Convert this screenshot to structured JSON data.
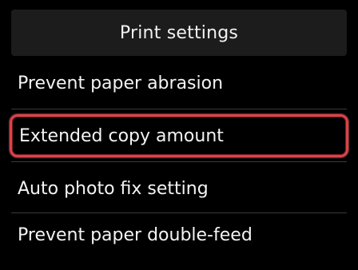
{
  "header": {
    "title": "Print settings"
  },
  "menu": {
    "items": [
      {
        "label": "Prevent paper abrasion",
        "selected": false
      },
      {
        "label": "Extended copy amount",
        "selected": true
      },
      {
        "label": "Auto photo fix setting",
        "selected": false
      },
      {
        "label": "Prevent paper double-feed",
        "selected": false
      }
    ]
  },
  "colors": {
    "background": "#000000",
    "text": "#ffffff",
    "selection_outline": "#d9434a",
    "header_background": "#1c1c1c",
    "divider": "#3a3a3a"
  }
}
